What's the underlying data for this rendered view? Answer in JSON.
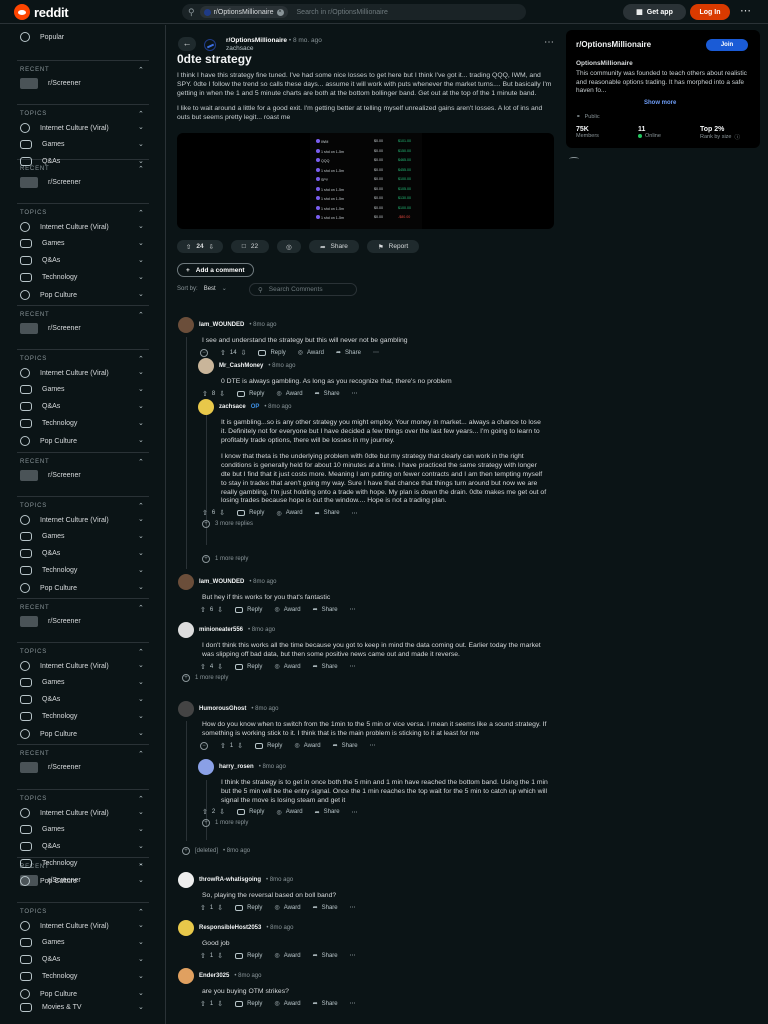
{
  "header": {
    "logo_text": "reddit",
    "search_chip": "r/OptionsMillionaire",
    "search_placeholder": "Search in r/OptionsMillionaire",
    "get_app": "Get app",
    "log_in": "Log In"
  },
  "sidebar": {
    "popular": "Popular",
    "recent_label": "RECENT",
    "topics_label": "TOPICS",
    "recent_item": "r/Screener",
    "topic_items": [
      "Internet Culture (Viral)",
      "Games",
      "Q&As",
      "Technology",
      "Pop Culture"
    ],
    "last_item": "Movies & TV"
  },
  "post": {
    "subreddit": "r/OptionsMillionaire",
    "age": "• 8 mo. ago",
    "author": "zachsace",
    "title": "0dte strategy",
    "body": [
      "I think I have this strategy fine tuned. I've had some nice losses to get here but I think I've got it... trading QQQ, IWM, and SPY. 0dte I follow the trend so calls these days... assume it will work with puts whenever the market turns.... But basically I'm getting in when the 1 and 5 minute charts are both at the bottom bollinger band. Get out at the top of the 1 minute band.",
      "I like to wait around a little for a good exit. I'm getting better at telling myself unrealized gains aren't losses. A lot of ins and outs but seems pretty legit... roast me"
    ],
    "image_rows": [
      {
        "l": "IWM",
        "m": "$0.00",
        "r": "$101.00",
        "c": "g"
      },
      {
        "l": "1 shd on 1-5m",
        "m": "$0.00",
        "r": "$150.00",
        "c": "g"
      },
      {
        "l": "QQQ",
        "m": "$0.00",
        "r": "$465.00",
        "c": "g"
      },
      {
        "l": "1 shd on 1-5m",
        "m": "$0.00",
        "r": "$455.00",
        "c": "g"
      },
      {
        "l": "SPY",
        "m": "$0.00",
        "r": "$100.00",
        "c": "g"
      },
      {
        "l": "1 shd on 1-5m",
        "m": "$0.00",
        "r": "$105.00",
        "c": "g"
      },
      {
        "l": "1 shd on 1-5m",
        "m": "$0.00",
        "r": "$130.00",
        "c": "g"
      },
      {
        "l": "1 shd on 1-5m",
        "m": "$0.00",
        "r": "$100.00",
        "c": "g"
      },
      {
        "l": "1 shd on 1-5m",
        "m": "$0.00",
        "r": "-$80.00",
        "c": "r"
      }
    ],
    "votes": "24",
    "comments": "22",
    "share": "Share",
    "report": "Report"
  },
  "comment_controls": {
    "add_comment": "Add a comment",
    "sort_by": "Sort by:",
    "sort_value": "Best",
    "search_placeholder": "Search Comments"
  },
  "labels": {
    "reply": "Reply",
    "award": "Award",
    "share": "Share",
    "op": "OP",
    "more_reply": "1 more reply",
    "more_replies_3": "3 more replies"
  },
  "comments": [
    {
      "user": "Iam_WOUNDED",
      "time": "• 8mo ago",
      "body": [
        "I see and understand the strategy but this will never not be gambling"
      ],
      "votes": "14"
    },
    {
      "user": "Mr_CashMoney",
      "time": "• 8mo ago",
      "body": [
        "0 DTE is always gambling. As long as you recognize that, there's no problem"
      ],
      "votes": "8"
    },
    {
      "user": "zachsace",
      "time": "• 8mo ago",
      "body": [
        "It is gambling...so is any other strategy you might employ. Your money in market... always a chance to lose it. Definitely not for everyone but I have decided a few things over the last few years... I'm going to learn to profitably trade options, there will be losses in my journey.",
        "I know that theta is the underlying problem with 0dte but my strategy that clearly can work in the right conditions is generally held for about 10 minutes at a time. I have practiced the same strategy with longer dte but I find that it just costs more. Meaning I am putting on fewer contracts and I am then tempting myself to stay in trades that aren't going my way. Sure I have that chance that things turn around but now we are really gambling, I'm just holding onto a trade with hope. My plan is down the drain. 0dte makes me get out of losing trades because hope is out the window.... Hope is not a trading plan."
      ],
      "votes": "6"
    },
    {
      "user": "Iam_WOUNDED",
      "time": "• 8mo ago",
      "body": [
        "But hey if this works for you that's fantastic"
      ],
      "votes": "6"
    },
    {
      "user": "minioneater556",
      "time": "• 8mo ago",
      "body": [
        "I don't think this works all the time because you got to keep in mind the data coming out. Earlier today the market was slipping off bad data, but then some positive news came out and made it reverse."
      ],
      "votes": "4"
    },
    {
      "user": "HumorousGhost",
      "time": "• 8mo ago",
      "body": [
        "How do you know when to switch from the 1min to the 5 min or vice versa. I mean it seems like a sound strategy. If something is working stick to it. I think that is the main problem is sticking to it at least for me"
      ],
      "votes": "1"
    },
    {
      "user": "harry_rosen",
      "time": "• 8mo ago",
      "body": [
        "I think the strategy is to get in once both the 5 min and 1 min have reached the bottom band. Using the 1 min but the 5 min will be the entry signal. Once the 1 min reaches the top wait for the 5 min to catch up which will signal the move is losing steam and get it"
      ],
      "votes": "2"
    },
    {
      "user": "[deleted]",
      "time": "• 8mo ago",
      "body": [],
      "votes": ""
    },
    {
      "user": "throwRA-whatisgoing",
      "time": "• 8mo ago",
      "body": [
        "So, playing the reversal based on boll band?"
      ],
      "votes": "1"
    },
    {
      "user": "ResponsibleHost2053",
      "time": "• 8mo ago",
      "body": [
        "Good job"
      ],
      "votes": "1"
    },
    {
      "user": "Ender3025",
      "time": "• 8mo ago",
      "body": [
        "are you buying OTM strikes?"
      ],
      "votes": "1"
    }
  ],
  "community": {
    "title": "r/OptionsMillionaire",
    "join": "Join",
    "name": "OptionsMillionaire",
    "description": "This community was founded to teach others about realistic and reasonable options trading. It has morphed into a safe haven fo...",
    "show_more": "Show more",
    "public": "Public",
    "members_value": "75K",
    "members_label": "Members",
    "online_value": "11",
    "online_label": "Online",
    "rank_value": "Top 2%",
    "rank_label": "Rank by size"
  },
  "colors": {
    "background": "#0b1416",
    "brand": "#ff4500",
    "login": "#d93a00",
    "join": "#1a5bd6",
    "op": "#3d8fe3"
  }
}
